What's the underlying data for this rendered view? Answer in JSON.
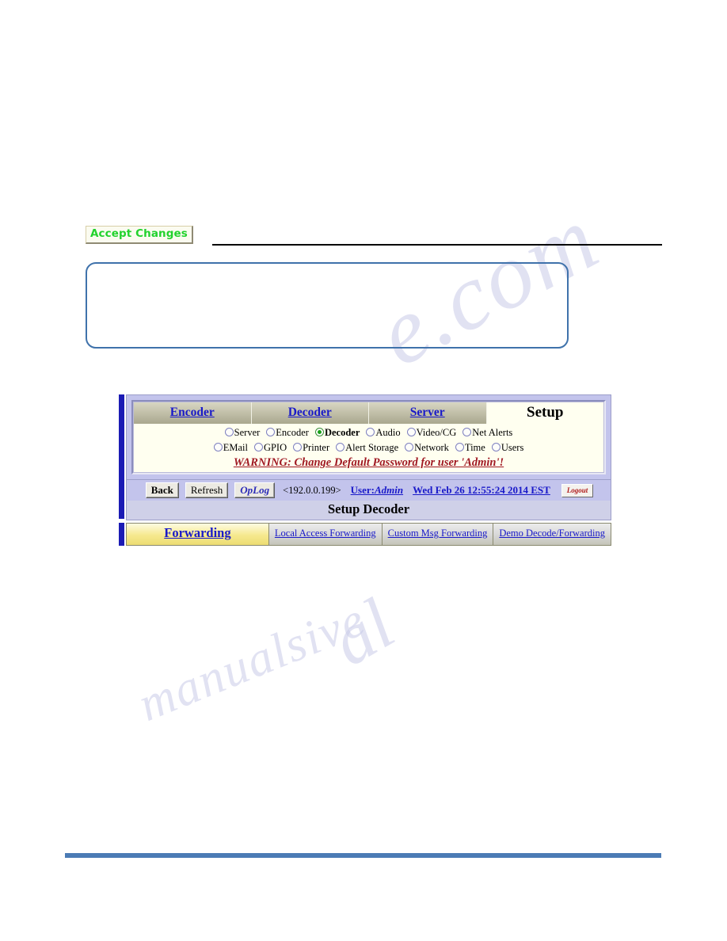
{
  "accept": {
    "label": "Accept Changes"
  },
  "device_panel": {
    "top_tabs": [
      {
        "label": "Encoder",
        "active": false
      },
      {
        "label": "Decoder",
        "active": false
      },
      {
        "label": "Server",
        "active": false
      },
      {
        "label": "Setup",
        "active": true
      }
    ],
    "radio_groups": [
      [
        {
          "label": "Server",
          "checked": false
        },
        {
          "label": "Encoder",
          "checked": false
        },
        {
          "label": "Decoder",
          "checked": true
        },
        {
          "label": "Audio",
          "checked": false
        },
        {
          "label": "Video/CG",
          "checked": false
        },
        {
          "label": "Net Alerts",
          "checked": false
        }
      ],
      [
        {
          "label": "EMail",
          "checked": false
        },
        {
          "label": "GPIO",
          "checked": false
        },
        {
          "label": "Printer",
          "checked": false
        },
        {
          "label": "Alert Storage",
          "checked": false
        },
        {
          "label": "Network",
          "checked": false
        },
        {
          "label": "Time",
          "checked": false
        },
        {
          "label": "Users",
          "checked": false
        }
      ]
    ],
    "warning": "WARNING: Change Default Password for user 'Admin'!",
    "toolbar": {
      "back_label": "Back",
      "refresh_label": "Refresh",
      "oplog_label": "OpLog",
      "ip_address": "<192.0.0.199>",
      "user_prefix": "User:",
      "user_name": "Admin",
      "datetime": "Wed Feb 26 12:55:24 2014 EST",
      "logout_label": "Logout"
    },
    "page_title": "Setup Decoder",
    "sub_tabs": [
      {
        "label": "Forwarding",
        "active": true
      },
      {
        "label": "Local Access Forwarding",
        "active": false
      },
      {
        "label": "Custom Msg Forwarding",
        "active": false
      },
      {
        "label": "Demo Decode/Forwarding",
        "active": false
      }
    ]
  },
  "watermark": {
    "line_a": "e.com",
    "line_b": "manualsive",
    "line_c": "al"
  },
  "colors": {
    "accept_text": "#22d22d",
    "link_blue": "#1919c9",
    "warning_red": "#a01822",
    "panel_lavender": "#c3c4ec",
    "card_ivory": "#fffff0",
    "active_subtab_yellow": "#f6e98e",
    "footer_blue": "#4b7bb5",
    "left_bar_blue": "#1b1bb4"
  }
}
